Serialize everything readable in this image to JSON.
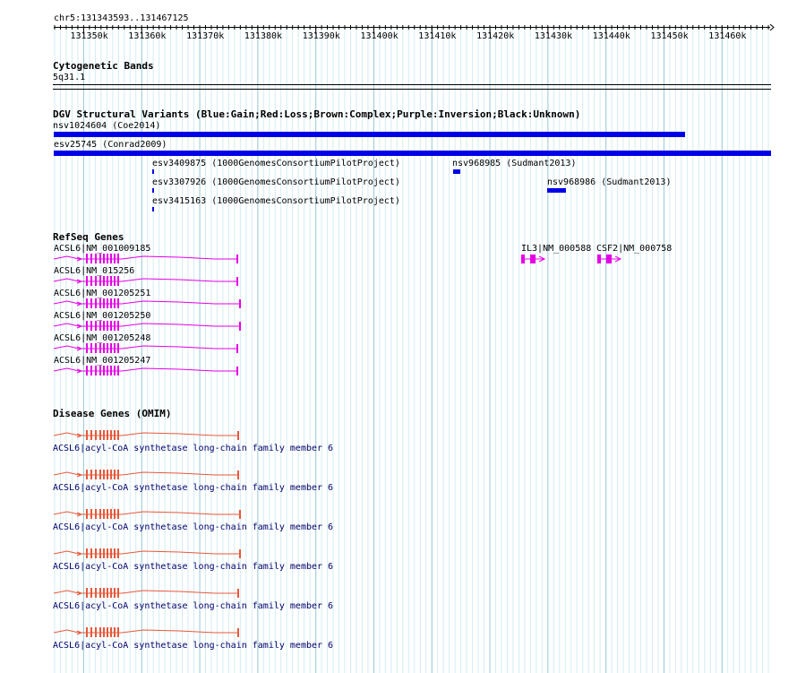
{
  "coordinates": "chr5:131343593..131467125",
  "ruler_ticks": [
    "131350k",
    "131360k",
    "131370k",
    "131380k",
    "131390k",
    "131400k",
    "131410k",
    "131420k",
    "131430k",
    "131440k",
    "131450k",
    "131460k"
  ],
  "cytoband": {
    "title": "Cytogenetic Bands",
    "band": "5q31.1"
  },
  "dgv": {
    "title": "DGV Structural Variants (Blue:Gain;Red:Loss;Brown:Complex;Purple:Inversion;Black:Unknown)",
    "variants": [
      "nsv1024604 (Coe2014)",
      "esv25745 (Conrad2009)",
      "esv3409875 (1000GenomesConsortiumPilotProject)",
      "nsv968985 (Sudmant2013)",
      "esv3307926 (1000GenomesConsortiumPilotProject)",
      "nsv968986 (Sudmant2013)",
      "esv3415163 (1000GenomesConsortiumPilotProject)"
    ]
  },
  "refseq": {
    "title": "RefSeq Genes",
    "genes": [
      "ACSL6|NM_001009185",
      "ACSL6|NM_015256",
      "ACSL6|NM_001205251",
      "ACSL6|NM_001205250",
      "ACSL6|NM_001205248",
      "ACSL6|NM_001205247",
      "IL3|NM_000588",
      "CSF2|NM_000758"
    ]
  },
  "omim": {
    "title": "Disease Genes (OMIM)",
    "entries": [
      "ACSL6|acyl-CoA synthetase long-chain family member 6",
      "ACSL6|acyl-CoA synthetase long-chain family member 6",
      "ACSL6|acyl-CoA synthetase long-chain family member 6",
      "ACSL6|acyl-CoA synthetase long-chain family member 6",
      "ACSL6|acyl-CoA synthetase long-chain family member 6",
      "ACSL6|acyl-CoA synthetase long-chain family member 6"
    ]
  },
  "colors": {
    "grid_minor": "#d3ecf2",
    "grid_major": "#9ccbd8",
    "gain": "#0000e6",
    "refseq": "#e600e6",
    "omim": "#e8583a",
    "omim_text": "#00006b"
  }
}
